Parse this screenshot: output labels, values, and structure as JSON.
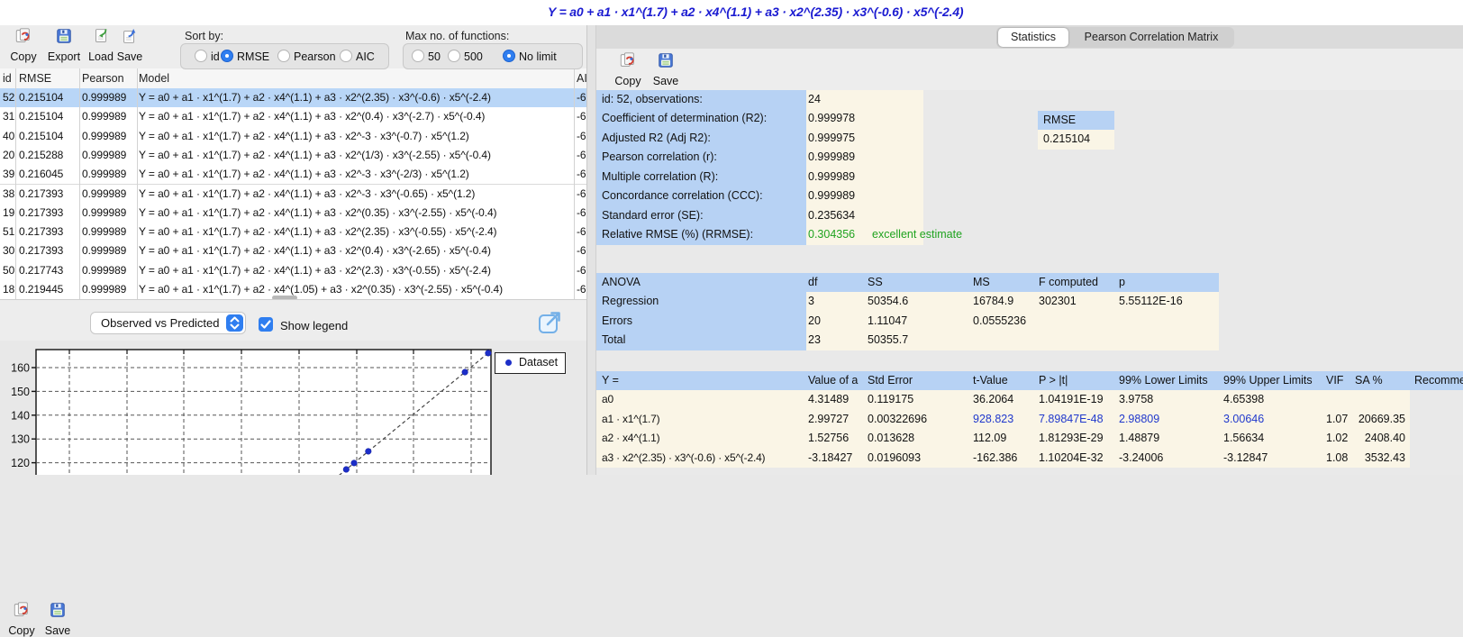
{
  "title": "Y = a0  + a1 · x1^(1.7) + a2 · x4^(1.1) + a3 · x2^(2.35) · x3^(-0.6) · x5^(-2.4)",
  "left_toolbar": {
    "buttons": [
      "Copy",
      "Export",
      "Load",
      "Save"
    ],
    "sort_by": {
      "label": "Sort by:",
      "options": [
        "id",
        "RMSE",
        "Pearson",
        "AIC"
      ],
      "selected": "RMSE"
    },
    "max_functions": {
      "label": "Max no. of functions:",
      "options": [
        "50",
        "500",
        "No limit"
      ],
      "selected": "No limit"
    }
  },
  "models_table": {
    "columns": [
      "id",
      "RMSE",
      "Pearson",
      "Model",
      "AIC"
    ],
    "selected_id": "52",
    "rows": [
      [
        "52",
        "0.215104",
        "0.999989",
        "Y = a0  + a1 · x1^(1.7) + a2 · x4^(1.1) + a3 · x2^(2.35) · x3^(-0.6) · x5^(-2.4)",
        "-6"
      ],
      [
        "31",
        "0.215104",
        "0.999989",
        "Y = a0  + a1 · x1^(1.7) + a2 · x4^(1.1) + a3 · x2^(0.4) · x3^(-2.7) · x5^(-0.4)",
        "-6"
      ],
      [
        "40",
        "0.215104",
        "0.999989",
        "Y = a0  + a1 · x1^(1.7) + a2 · x4^(1.1) + a3 · x2^-3 · x3^(-0.7) · x5^(1.2)",
        "-6"
      ],
      [
        "20",
        "0.215288",
        "0.999989",
        "Y = a0  + a1 · x1^(1.7) + a2 · x4^(1.1) + a3 · x2^(1/3) · x3^(-2.55) · x5^(-0.4)",
        "-6"
      ],
      [
        "39",
        "0.216045",
        "0.999989",
        "Y = a0  + a1 · x1^(1.7) + a2 · x4^(1.1) + a3 · x2^-3 · x3^(-2/3) · x5^(1.2)",
        "-6"
      ],
      [
        "38",
        "0.217393",
        "0.999989",
        "Y = a0  + a1 · x1^(1.7) + a2 · x4^(1.1) + a3 · x2^-3 · x3^(-0.65) · x5^(1.2)",
        "-6"
      ],
      [
        "19",
        "0.217393",
        "0.999989",
        "Y = a0  + a1 · x1^(1.7) + a2 · x4^(1.1) + a3 · x2^(0.35) · x3^(-2.55) · x5^(-0.4)",
        "-6"
      ],
      [
        "51",
        "0.217393",
        "0.999989",
        "Y = a0  + a1 · x1^(1.7) + a2 · x4^(1.1) + a3 · x2^(2.35) · x3^(-0.55) · x5^(-2.4)",
        "-6"
      ],
      [
        "30",
        "0.217393",
        "0.999989",
        "Y = a0  + a1 · x1^(1.7) + a2 · x4^(1.1) + a3 · x2^(0.4) · x3^(-2.65) · x5^(-0.4)",
        "-6"
      ],
      [
        "50",
        "0.217743",
        "0.999989",
        "Y = a0  + a1 · x1^(1.7) + a2 · x4^(1.1) + a3 · x2^(2.3) · x3^(-0.55) · x5^(-2.4)",
        "-6"
      ],
      [
        "18",
        "0.219445",
        "0.999989",
        "Y = a0  + a1 · x1^(1.7) + a2 · x4^(1.05) + a3 · x2^(0.35) · x3^(-2.55) · x5^(-0.4)",
        "-6"
      ]
    ]
  },
  "plot_toolbar": {
    "copy": "Copy",
    "save": "Save",
    "view": "Observed vs Predicted",
    "show_legend": "Show legend",
    "legend_checked": true
  },
  "chart_data": {
    "type": "scatter",
    "title": "Observed vs Predicted",
    "legend": [
      {
        "label": "Dataset",
        "color": "#1c2ec8"
      }
    ],
    "yticks": [
      120,
      130,
      140,
      150,
      160
    ],
    "ylim_visible": [
      114.5,
      167.6
    ],
    "grid": "dashed",
    "identity_line": true,
    "points_observed_predicted": [
      [
        117.2,
        117.2
      ],
      [
        119.9,
        119.9
      ],
      [
        124.8,
        124.8
      ],
      [
        158.1,
        158.1
      ],
      [
        166.1,
        166.1
      ]
    ]
  },
  "right_panel": {
    "tabs": [
      {
        "label": "Statistics",
        "active": true
      },
      {
        "label": "Pearson Correlation Matrix",
        "active": false
      }
    ],
    "toolbar": {
      "copy": "Copy",
      "save": "Save"
    },
    "stats": {
      "rows": [
        {
          "label": "id: 52, observations:",
          "value": "24"
        },
        {
          "label": "Coefficient of determination (R2):",
          "value": "0.999978"
        },
        {
          "label": "Adjusted R2 (Adj R2):",
          "value": "0.999975"
        },
        {
          "label": "Pearson correlation (r):",
          "value": "0.999989"
        },
        {
          "label": "Multiple correlation (R):",
          "value": "0.999989"
        },
        {
          "label": "Concordance correlation (CCC):",
          "value": "0.999989"
        },
        {
          "label": "Standard error (SE):",
          "value": "0.235634"
        },
        {
          "label": "Relative RMSE (%) (RRMSE):",
          "value": "0.304356",
          "green": true,
          "note": "excellent estimate"
        }
      ],
      "rmse_box": {
        "header": "RMSE",
        "value": "0.215104"
      }
    },
    "anova": {
      "columns": [
        "ANOVA",
        "df",
        "SS",
        "MS",
        "F computed",
        "p"
      ],
      "rows": [
        [
          "Regression",
          "3",
          "50354.6",
          "16784.9",
          "302301",
          "5.55112E-16"
        ],
        [
          "Errors",
          "20",
          "1.11047",
          "0.0555236",
          "",
          ""
        ],
        [
          "Total",
          "23",
          "50355.7",
          "",
          "",
          ""
        ]
      ]
    },
    "coefficients": {
      "columns": [
        "Y =",
        "Value of a",
        "Std Error",
        "t-Value",
        "P > |t|",
        "99% Lower Limits",
        "99% Upper Limits",
        "VIF",
        "SA %",
        "Recommended"
      ],
      "rows": [
        {
          "cells": [
            "a0",
            "4.31489",
            "0.119175",
            "36.2064",
            "1.04191E-19",
            "3.9758",
            "4.65398",
            "",
            ""
          ],
          "blue": false
        },
        {
          "cells": [
            "a1 · x1^(1.7)",
            "2.99727",
            "0.00322696",
            "928.823",
            "7.89847E-48",
            "2.98809",
            "3.00646",
            "1.07",
            "20669.35"
          ],
          "blue": true
        },
        {
          "cells": [
            "a2 · x4^(1.1)",
            "1.52756",
            "0.013628",
            "112.09",
            "1.81293E-29",
            "1.48879",
            "1.56634",
            "1.02",
            "2408.40"
          ],
          "blue": false
        },
        {
          "cells": [
            "a3 · x2^(2.35) · x3^(-0.6) · x5^(-2.4)",
            "-3.18427",
            "0.0196093",
            "-162.386",
            "1.10204E-32",
            "-3.24006",
            "-3.12847",
            "1.08",
            "3532.43"
          ],
          "blue": false
        }
      ]
    }
  },
  "colors": {
    "accent_blue": "#2f7ef0",
    "selection_blue": "#b9d6f7",
    "cell_blue": "#b7d2f4",
    "cell_cream": "#faf5e6",
    "title_blue": "#1b1bd1",
    "good_green": "#1fa31f",
    "value_blue": "#2038cc",
    "point_blue": "#1c2ec8"
  }
}
